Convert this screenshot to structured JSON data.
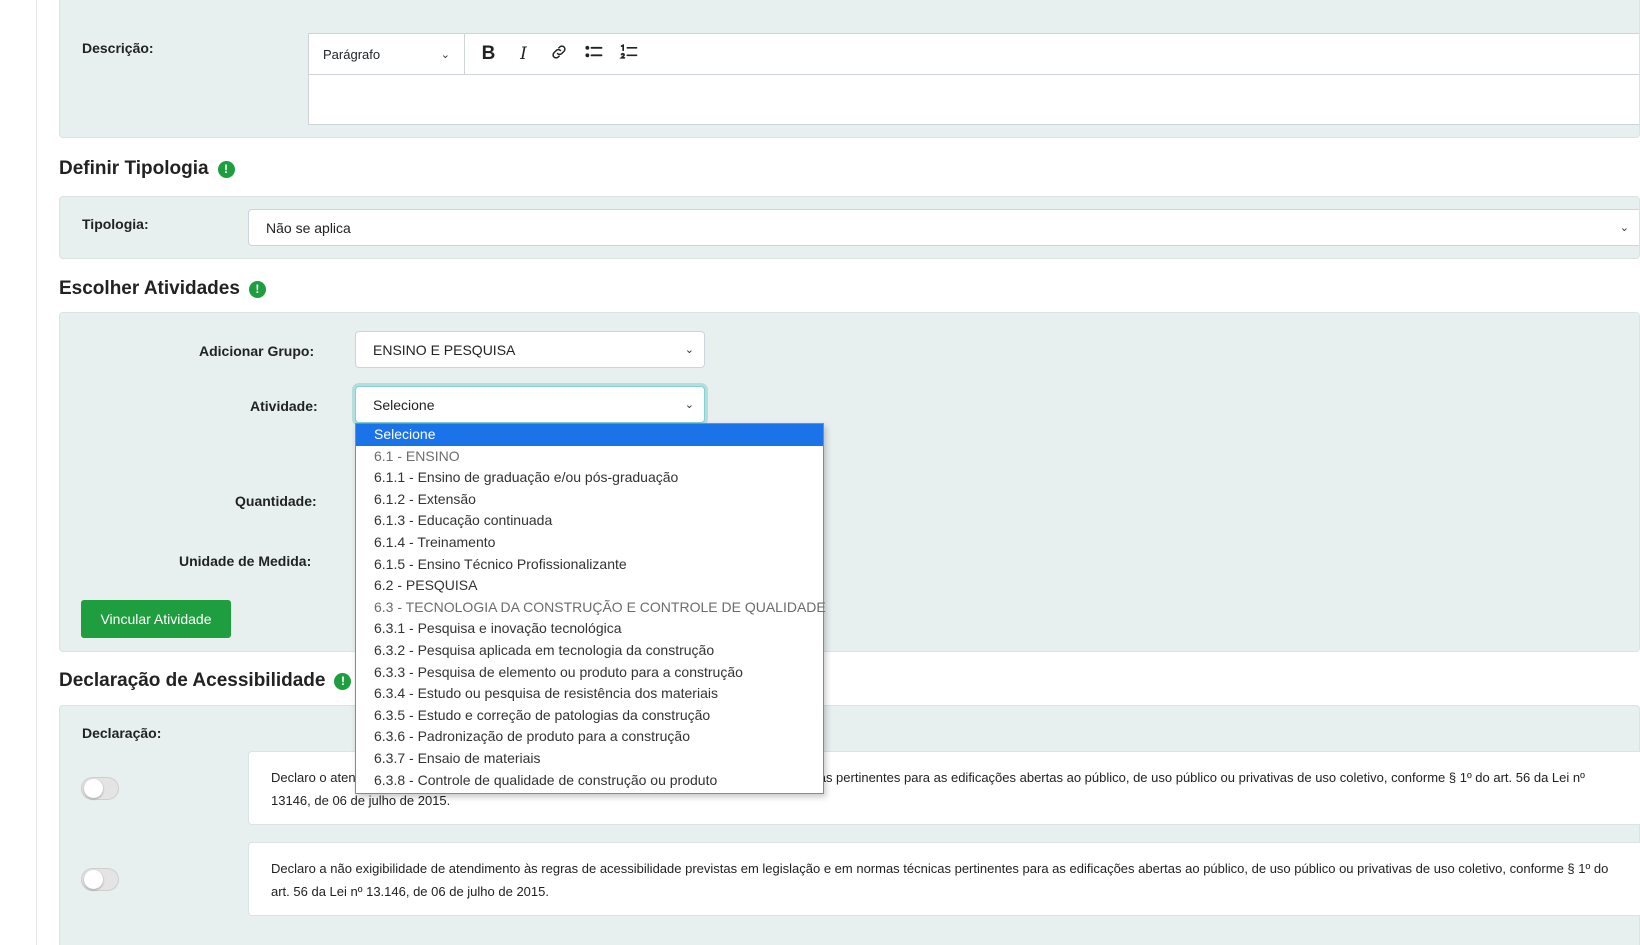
{
  "descricao": {
    "label": "Descrição:",
    "format_select": "Parágrafo",
    "toolbar": {
      "bold_icon": "B",
      "italic_icon": "I",
      "link_icon": "link-icon",
      "bullet_list_icon": "bullet-list-icon",
      "numbered_list_icon": "numbered-list-icon"
    }
  },
  "tipologia": {
    "section_title": "Definir Tipologia",
    "label": "Tipologia:",
    "value": "Não se aplica"
  },
  "atividades": {
    "section_title": "Escolher Atividades",
    "grupo_label": "Adicionar Grupo:",
    "grupo_value": "ENSINO E PESQUISA",
    "atividade_label": "Atividade:",
    "atividade_value": "Selecione",
    "quantidade_label": "Quantidade:",
    "unidade_label": "Unidade de Medida:",
    "vincular_button": "Vincular Atividade",
    "dropdown_options": [
      {
        "label": "Selecione",
        "selected": true,
        "group": false
      },
      {
        "label": "6.1 - ENSINO",
        "selected": false,
        "group": true
      },
      {
        "label": "6.1.1 - Ensino de graduação e/ou pós-graduação",
        "selected": false,
        "group": false
      },
      {
        "label": "6.1.2 - Extensão",
        "selected": false,
        "group": false
      },
      {
        "label": "6.1.3 - Educação continuada",
        "selected": false,
        "group": false
      },
      {
        "label": "6.1.4 - Treinamento",
        "selected": false,
        "group": false
      },
      {
        "label": "6.1.5 - Ensino Técnico Profissionalizante",
        "selected": false,
        "group": false
      },
      {
        "label": "6.2 - PESQUISA",
        "selected": false,
        "group": false
      },
      {
        "label": "6.3 - TECNOLOGIA DA CONSTRUÇÃO E CONTROLE DE QUALIDADE",
        "selected": false,
        "group": true
      },
      {
        "label": "6.3.1 - Pesquisa e inovação tecnológica",
        "selected": false,
        "group": false
      },
      {
        "label": "6.3.2 - Pesquisa aplicada em tecnologia da construção",
        "selected": false,
        "group": false
      },
      {
        "label": "6.3.3 - Pesquisa de elemento ou produto para a construção",
        "selected": false,
        "group": false
      },
      {
        "label": "6.3.4 - Estudo ou pesquisa de resistência dos materiais",
        "selected": false,
        "group": false
      },
      {
        "label": "6.3.5 - Estudo e correção de patologias da construção",
        "selected": false,
        "group": false
      },
      {
        "label": "6.3.6 - Padronização de produto para a construção",
        "selected": false,
        "group": false
      },
      {
        "label": "6.3.7 - Ensaio de materiais",
        "selected": false,
        "group": false
      },
      {
        "label": "6.3.8 - Controle de qualidade de construção ou produto",
        "selected": false,
        "group": false
      }
    ]
  },
  "acessibilidade": {
    "section_title": "Declaração de Acessibilidade",
    "label": "Declaração:",
    "declarations": [
      {
        "text": "Declaro o atendimento às regras de acessibilidade previstas em legislação e em normas técnicas pertinentes para as edificações abertas ao público, de uso público ou privativas de uso coletivo, conforme § 1º do art. 56 da Lei nº 13146, de 06 de julho de 2015.",
        "checked": false
      },
      {
        "text": "Declaro a não exigibilidade de atendimento às regras de acessibilidade previstas em legislação e em normas técnicas pertinentes para as edificações abertas ao público, de uso público ou privativas de uso coletivo, conforme § 1º do art. 56 da Lei nº 13.146, de 06 de julho de 2015.",
        "checked": false
      }
    ]
  },
  "colors": {
    "accent_green": "#1e9e3e",
    "card_bg": "#e7f0ef",
    "option_highlight": "#1a73e8"
  }
}
